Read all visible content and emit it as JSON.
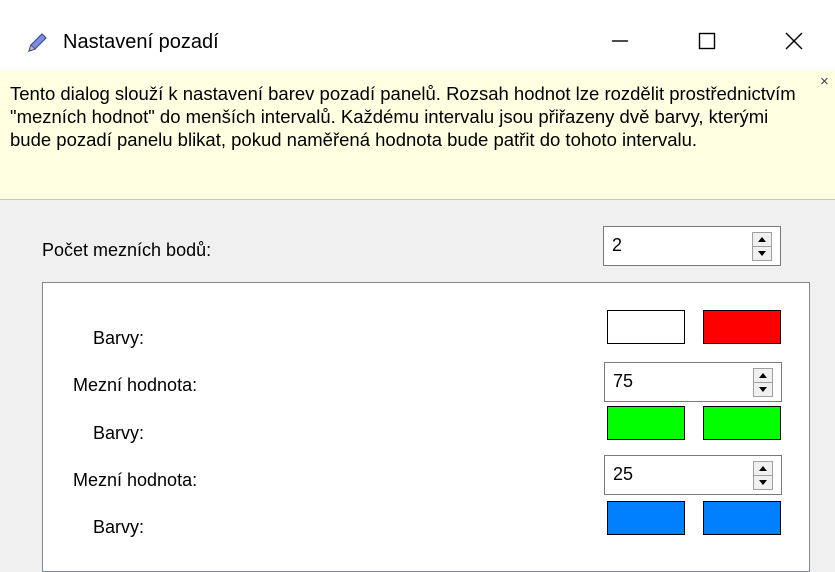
{
  "window": {
    "title": "Nastavení pozadí",
    "icon": "pencil-icon",
    "controls": {
      "minimize": "—",
      "maximize": "☐",
      "close": "✕"
    }
  },
  "info": {
    "text": "Tento dialog slouží k nastavení barev pozadí panelů. Rozsah hodnot lze rozdělit prostřednictvím \"mezních hodnot\" do menších intervalů. Každému intervalu jsou přiřazeny dvě barvy, kterými bude pozadí panelu blikat, pokud naměřená hodnota bude patřit do tohoto intervalu.",
    "close": "×"
  },
  "count": {
    "label": "Počet mezních bodů:",
    "value": "2"
  },
  "panel": {
    "colors_label": "Barvy:",
    "threshold_label": "Mezní hodnota:",
    "rows": [
      {
        "colors": [
          "#ffffff",
          "#ff0000"
        ]
      },
      {
        "threshold": "75",
        "colors": [
          "#00ff00",
          "#00ff00"
        ]
      },
      {
        "threshold": "25",
        "colors": [
          "#0080ff",
          "#0080ff"
        ]
      }
    ]
  }
}
